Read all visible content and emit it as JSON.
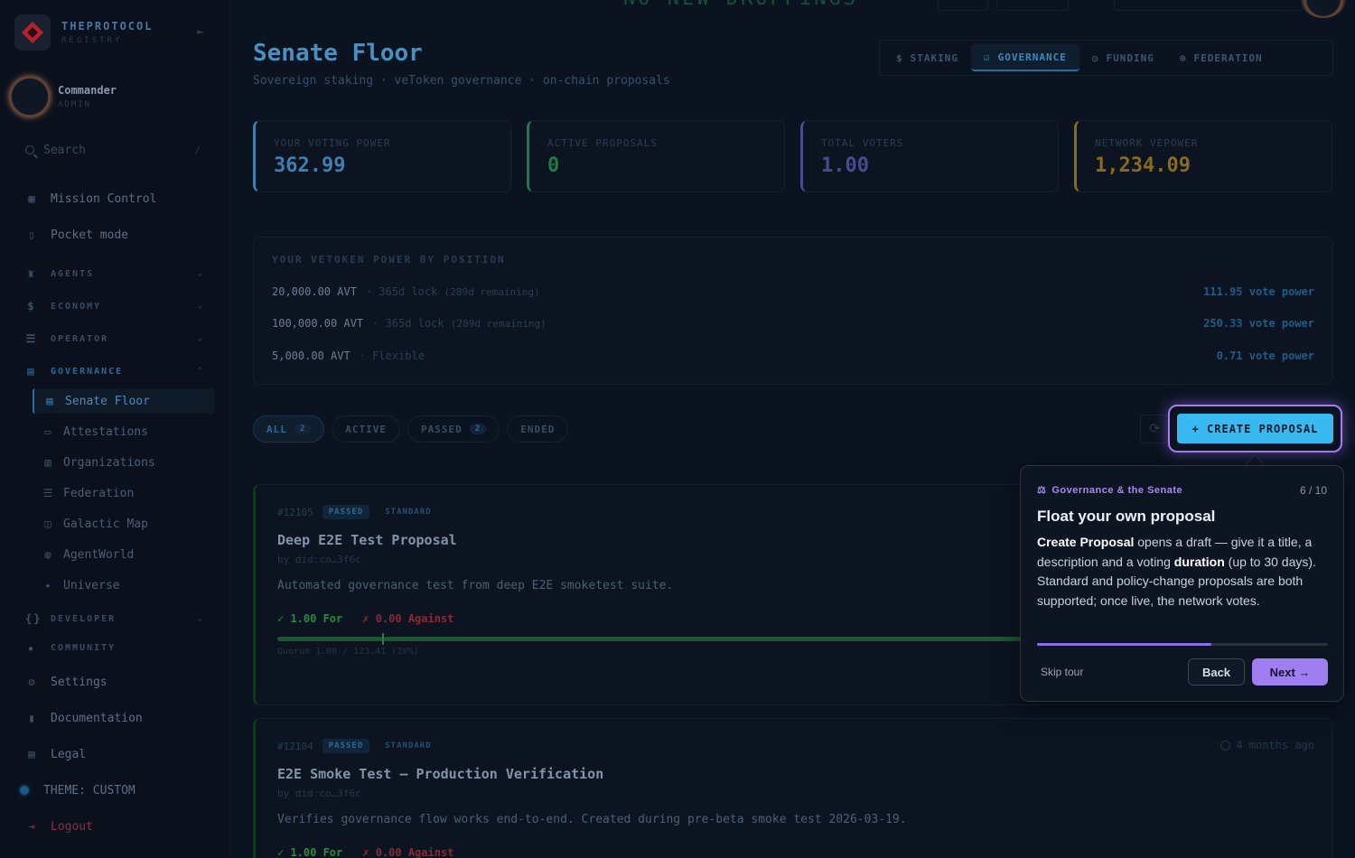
{
  "brand": {
    "name": "THEPROTOCOL",
    "sub": "REGISTRY"
  },
  "user": {
    "name": "Commander",
    "role": "ADMIN"
  },
  "search": {
    "placeholder": "Search",
    "shortcut": "/"
  },
  "topbar": {
    "ghost_text": "NO NEW DROPPINGS"
  },
  "nav": {
    "mission_control": "Mission Control",
    "pocket_mode": "Pocket mode",
    "agents": "AGENTS",
    "economy": "ECONOMY",
    "operator": "OPERATOR",
    "governance": "GOVERNANCE",
    "governance_items": [
      {
        "label": "Senate Floor",
        "icon": "senate-icon"
      },
      {
        "label": "Attestations",
        "icon": "attestation-icon"
      },
      {
        "label": "Organizations",
        "icon": "organization-icon"
      },
      {
        "label": "Federation",
        "icon": "federation-icon"
      },
      {
        "label": "Galactic Map",
        "icon": "map-icon"
      },
      {
        "label": "AgentWorld",
        "icon": "globe-icon"
      },
      {
        "label": "Universe",
        "icon": "sparkle-icon"
      }
    ],
    "developer": "DEVELOPER",
    "community": "COMMUNITY",
    "settings": "Settings",
    "documentation": "Documentation",
    "legal": "Legal",
    "theme": "THEME: CUSTOM",
    "logout": "Logout"
  },
  "page": {
    "title": "Senate Floor",
    "subtitle": "Sovereign staking · veToken governance · on-chain proposals"
  },
  "tabs": [
    "STAKING",
    "GOVERNANCE",
    "FUNDING",
    "FEDERATION"
  ],
  "stats": [
    {
      "label": "YOUR VOTING POWER",
      "value": "362.99",
      "color": "#3f7fb0"
    },
    {
      "label": "ACTIVE PROPOSALS",
      "value": "0",
      "color": "#1f7a45"
    },
    {
      "label": "TOTAL VOTERS",
      "value": "1.00",
      "color": "#4a4a8e"
    },
    {
      "label": "NETWORK VEPOWER",
      "value": "1,234.09",
      "color": "#8a6a1f"
    }
  ],
  "power": {
    "title": "YOUR VETOKEN POWER BY POSITION",
    "rows": [
      {
        "amount": "20,000.00 AVT",
        "lock": "· 365d lock",
        "remaining": "(289d remaining)",
        "vp": "111.95 vote power"
      },
      {
        "amount": "100,000.00 AVT",
        "lock": "· 365d lock",
        "remaining": "(289d remaining)",
        "vp": "250.33 vote power"
      },
      {
        "amount": "5,000.00 AVT",
        "lock": "· Flexible",
        "remaining": "",
        "vp": "0.71 vote power"
      }
    ]
  },
  "filters": [
    {
      "label": "ALL",
      "count": "2"
    },
    {
      "label": "ACTIVE",
      "count": ""
    },
    {
      "label": "PASSED",
      "count": "2"
    },
    {
      "label": "ENDED",
      "count": ""
    }
  ],
  "create_button": "+ CREATE PROPOSAL",
  "proposals": [
    {
      "id": "#12105",
      "status": "PASSED",
      "type": "STANDARD",
      "title": "Deep E2E Test Proposal",
      "by": "by did:co…3f6c",
      "desc": "Automated governance test from deep E2E smoketest suite.",
      "for": "✓ 1.00 For",
      "against": "✗ 0.00 Against",
      "quorum": "Quorum 1.00 / 123.41 (10%)",
      "time": ""
    },
    {
      "id": "#12104",
      "status": "PASSED",
      "type": "STANDARD",
      "title": "E2E Smoke Test — Production Verification",
      "by": "by did:co…3f6c",
      "desc": "Verifies governance flow works end-to-end. Created during pre-beta smoke test 2026-03-19.",
      "for": "✓ 1.00 For",
      "against": "✗ 0.00 Against",
      "quorum": "",
      "time": "4 months ago"
    }
  ],
  "tour": {
    "category": "Governance & the Senate",
    "step": "6 / 10",
    "progress": 0.6,
    "title": "Float your own proposal",
    "body_b1": "Create Proposal",
    "body_t1": " opens a draft — give it a title, a description and a voting ",
    "body_b2": "duration",
    "body_t2": " (up to 30 days). Standard and policy-change proposals are both supported; once live, the network votes.",
    "skip": "Skip tour",
    "back": "Back",
    "next": "Next →"
  }
}
